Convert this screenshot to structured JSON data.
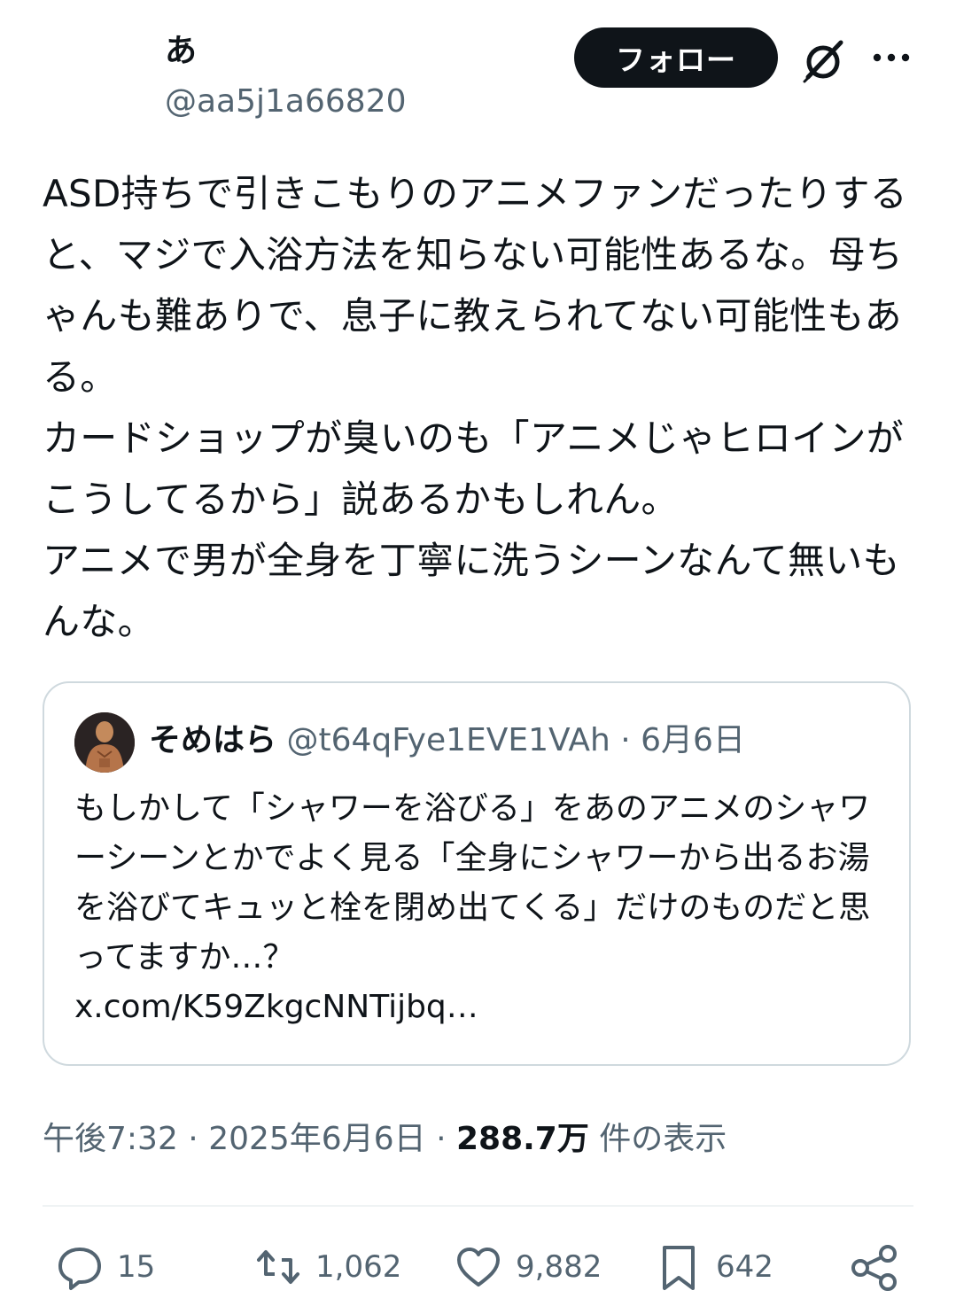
{
  "author": {
    "display_name": "あ",
    "handle": "@aa5j1a66820"
  },
  "header": {
    "follow_label": "フォロー",
    "grok_icon": "grok-icon",
    "more_icon": "more-icon"
  },
  "tweet": {
    "text": "ASD持ちで引きこもりのアニメファンだったりすると、マジで入浴方法を知らない可能性あるな。母ちゃんも難ありで、息子に教えられてない可能性もある。\nカードショップが臭いのも「アニメじゃヒロインがこうしてるから」説あるかもしれん。\nアニメで男が全身を丁寧に洗うシーンなんて無いもんな。"
  },
  "quote": {
    "display_name": "そめはら",
    "handle": "@t64qFye1EVE1VAh",
    "separator": " · ",
    "date": "6月6日",
    "text": "もしかして「シャワーを浴びる」をあのアニメのシャワーシーンとかでよく見る「全身にシャワーから出るお湯を浴びてキュッと栓を閉め出てくる」だけのものだと思ってますか…？",
    "link": "x.com/K59ZkgcNNTijbq…"
  },
  "meta": {
    "time": "午後7:32",
    "sep1": " · ",
    "date": "2025年6月6日",
    "sep2": " · ",
    "views": "288.7万",
    "views_suffix": " 件の表示"
  },
  "actions": {
    "replies": "15",
    "reposts": "1,062",
    "likes": "9,882",
    "bookmarks": "642"
  },
  "colors": {
    "text": "#0f1419",
    "secondary": "#536471",
    "border": "#cfd9de",
    "follow_bg": "#0f1419"
  }
}
